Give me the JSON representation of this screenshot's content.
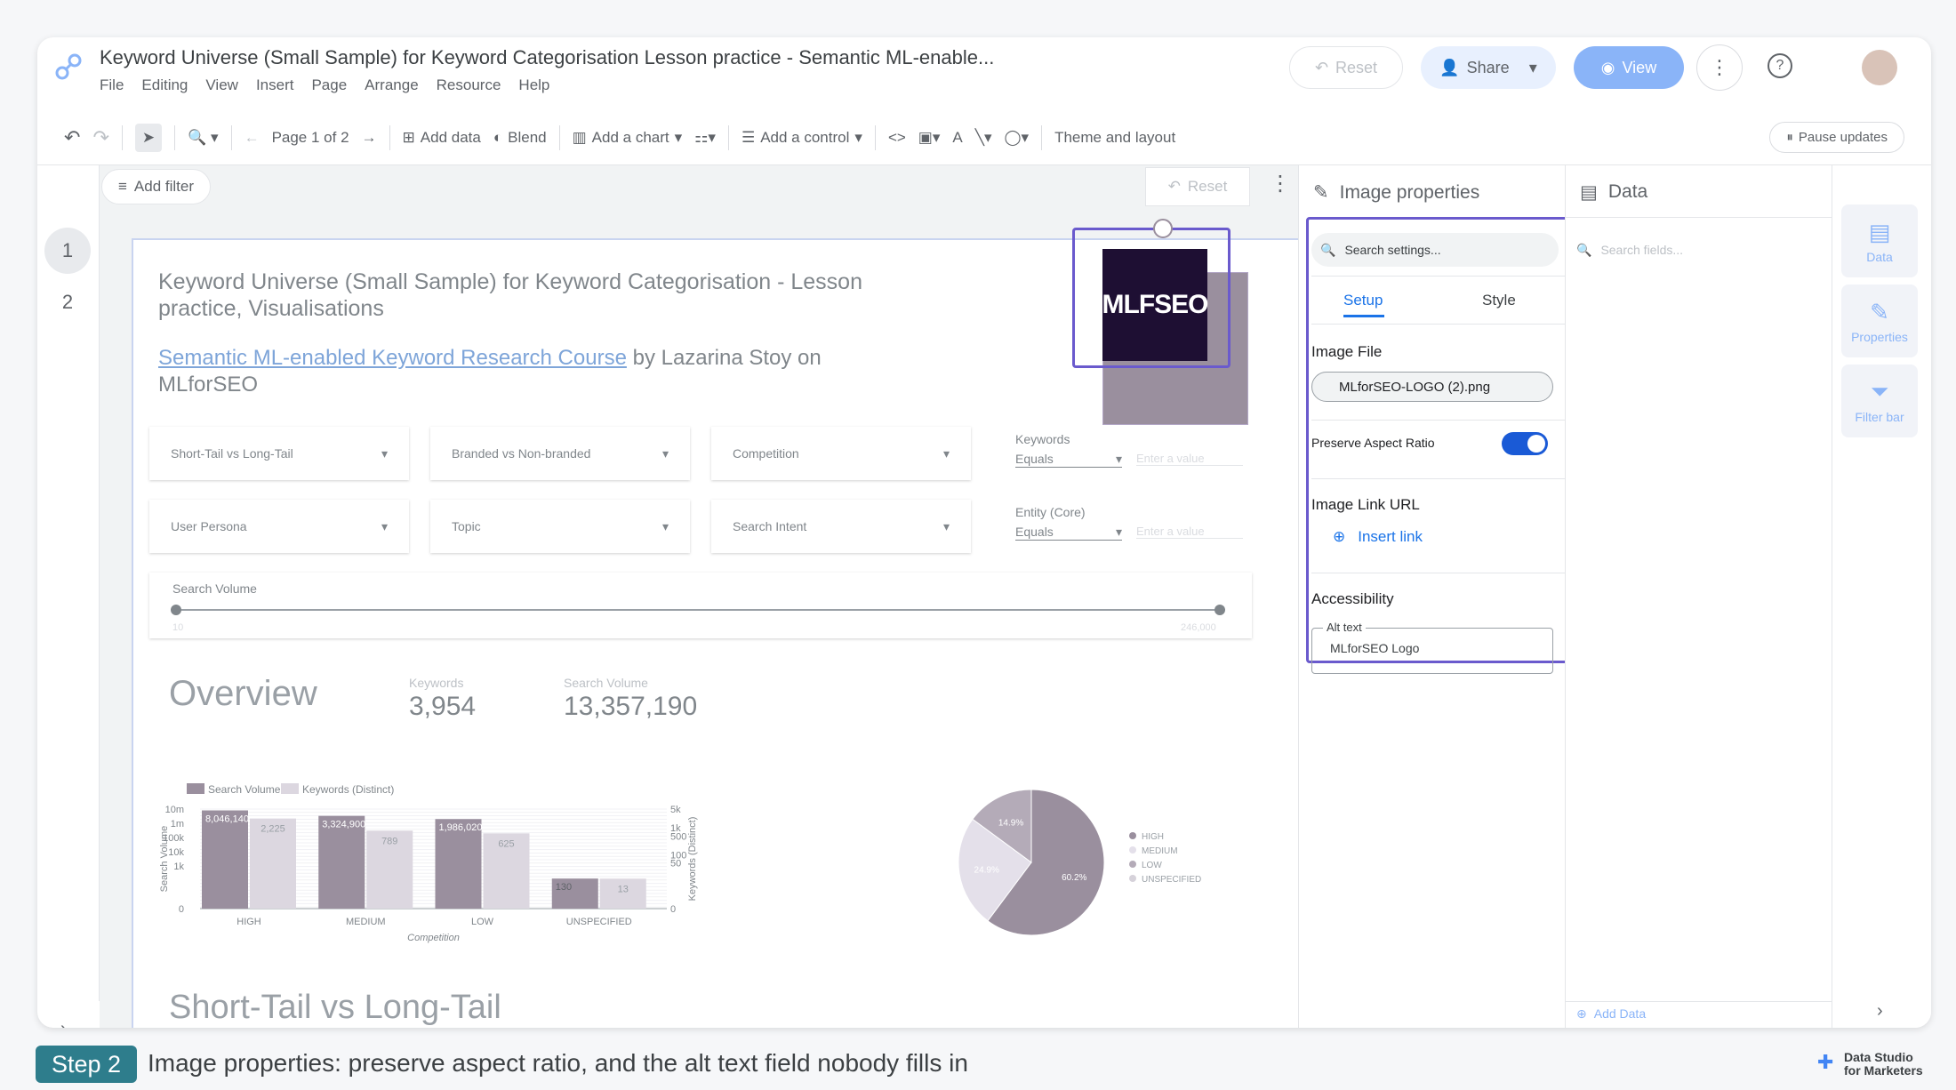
{
  "header": {
    "title": "Keyword Universe (Small Sample) for Keyword Categorisation Lesson practice - Semantic ML-enable...",
    "menu": [
      "File",
      "Editing",
      "View",
      "Insert",
      "Page",
      "Arrange",
      "Resource",
      "Help"
    ],
    "reset": "Reset",
    "share": "Share",
    "view": "View"
  },
  "toolbar": {
    "page": "Page 1 of 2",
    "add_data": "Add data",
    "blend": "Blend",
    "add_chart": "Add a chart",
    "add_control": "Add a control",
    "theme": "Theme and layout",
    "pause": "Pause updates"
  },
  "pages": [
    "1",
    "2"
  ],
  "filterbar": {
    "add_filter": "Add filter",
    "reset": "Reset"
  },
  "report": {
    "title": "Keyword Universe (Small Sample) for Keyword Categorisation - Lesson practice, Visualisations",
    "link_text": "Semantic ML-enabled Keyword Research Course",
    "by_text": " by Lazarina Stoy on MLforSEO",
    "logo_text": "MLFSEO",
    "controls_row1": [
      "Short-Tail vs Long-Tail",
      "Branded vs Non-branded",
      "Competition"
    ],
    "controls_row2": [
      "User Persona",
      "Topic",
      "Search Intent"
    ],
    "kw_filter": {
      "label": "Keywords",
      "op": "Equals",
      "placeholder": "Enter a value"
    },
    "entity_filter": {
      "label": "Entity (Core)",
      "op": "Equals",
      "placeholder": "Enter a value"
    },
    "slider": {
      "label": "Search Volume",
      "min": "10",
      "max": "246,000"
    },
    "overview": "Overview",
    "kpi_keywords_label": "Keywords",
    "kpi_keywords": "3,954",
    "kpi_sv_label": "Search Volume",
    "kpi_sv": "13,357,190",
    "next_section": "Short-Tail vs Long-Tail"
  },
  "chart_data": [
    {
      "type": "bar",
      "categories": [
        "HIGH",
        "MEDIUM",
        "LOW",
        "UNSPECIFIED"
      ],
      "series": [
        {
          "name": "Search Volume",
          "values": [
            8046140,
            3324900,
            1986020,
            130
          ],
          "labels": [
            "8,046,140",
            "3,324,900",
            "1,986,020",
            "130"
          ]
        },
        {
          "name": "Keywords (Distinct)",
          "values": [
            2225,
            789,
            625,
            13
          ],
          "labels": [
            "2,225",
            "789",
            "625",
            "13"
          ]
        }
      ],
      "xlabel": "Competition",
      "ylabel": "Search Volume",
      "y2label": "Keywords (Distinct)",
      "yscale": "log",
      "yticks": [
        "10m",
        "1m",
        "100k",
        "10k",
        "1k",
        "0"
      ],
      "y2ticks": [
        "5k",
        "1k",
        "500",
        "100",
        "50",
        "0"
      ],
      "colors": [
        "#9a8f9e",
        "#dcd7e0"
      ]
    },
    {
      "type": "pie",
      "categories": [
        "HIGH",
        "MEDIUM",
        "LOW",
        "UNSPECIFIED"
      ],
      "values": [
        60.2,
        24.9,
        14.9,
        0
      ],
      "labels": [
        "60.2%",
        "24.9%",
        "14.9%",
        ""
      ],
      "colors": [
        "#9a8f9e",
        "#e4e0ea",
        "#b4abb8",
        "#d6d2da"
      ]
    }
  ],
  "props": {
    "title": "Image properties",
    "search": "Search settings...",
    "tab_setup": "Setup",
    "tab_style": "Style",
    "image_file_label": "Image File",
    "image_file": "MLforSEO-LOGO (2).png",
    "aspect_label": "Preserve Aspect Ratio",
    "link_label": "Image Link URL",
    "insert_link": "Insert link",
    "access_label": "Accessibility",
    "alt_label": "Alt text",
    "alt_value": "MLforSEO Logo"
  },
  "data_panel": {
    "title": "Data",
    "search": "Search fields...",
    "add_data": "Add Data"
  },
  "rail": {
    "data": "Data",
    "properties": "Properties",
    "filter": "Filter bar"
  },
  "caption": {
    "step": "Step 2",
    "text": "Image properties: preserve aspect ratio, and the alt text field nobody fills in",
    "brand1": "Data Studio",
    "brand2": "for Marketers"
  },
  "colors": {
    "accent": "#1a73e8",
    "step_bg": "#2e7d8c",
    "bar1": "#9a8f9e",
    "bar2": "#dcd7e0",
    "logo_bg": "#1e0f33"
  }
}
